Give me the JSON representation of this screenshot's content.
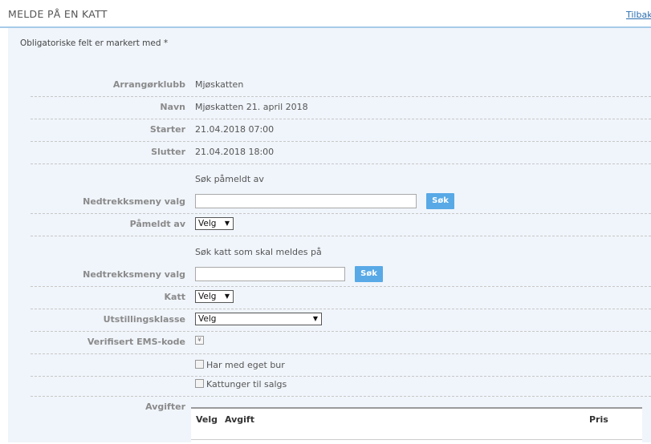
{
  "header": {
    "title": "MELDE PÅ EN KATT",
    "back_link": "Tilbake"
  },
  "form": {
    "required_note": "Obligatoriske felt er markert med *",
    "organizer_club_label": "Arrangørklubb",
    "organizer_club_value": "Mjøskatten",
    "name_label": "Navn",
    "name_value": "Mjøskatten 21. april 2018",
    "starts_label": "Starter",
    "starts_value": "21.04.2018 07:00",
    "ends_label": "Slutter",
    "ends_value": "21.04.2018 18:00",
    "search_registered_heading": "Søk påmeldt av",
    "dropdown_label_1": "Nedtrekksmeny valg",
    "search_button_1": "Søk",
    "registered_by_label": "Påmeldt av",
    "registered_by_value": "Velg",
    "search_cat_heading": "Søk katt som skal meldes på",
    "dropdown_label_2": "Nedtrekksmeny valg",
    "search_button_2": "Søk",
    "cat_label": "Katt",
    "cat_value": "Velg",
    "class_label": "Utstillingsklasse",
    "class_value": "Velg",
    "ems_label": "Verifisert EMS-kode",
    "own_cage_label": "Har med eget bur",
    "kittens_label": "Kattunger til salgs",
    "fees_label": "Avgifter",
    "fees_table": {
      "col_select": "Velg",
      "col_fee": "Avgift",
      "col_price": "Pris"
    }
  }
}
